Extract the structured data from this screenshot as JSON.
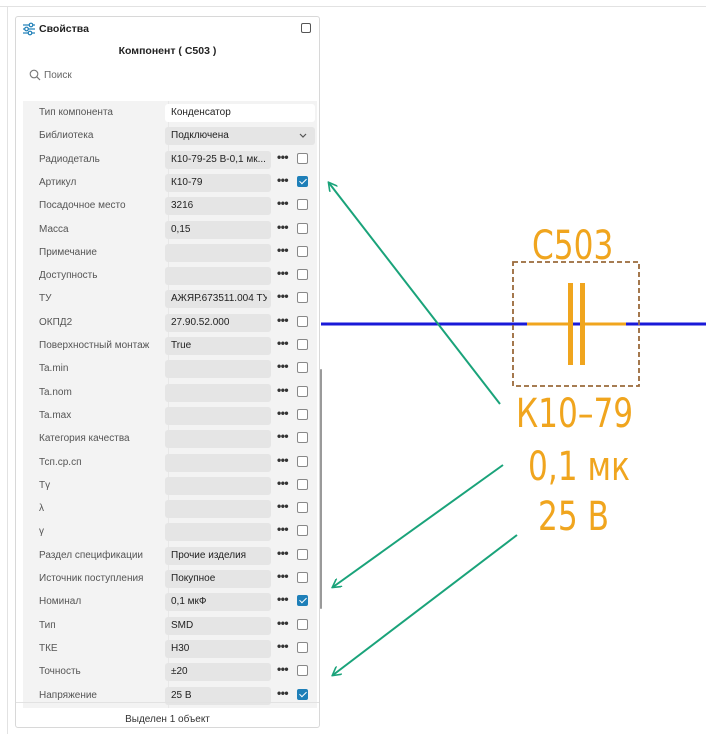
{
  "panel": {
    "title": "Свойства",
    "component_title": "Компонент ( С503 )",
    "search": {
      "placeholder": "Поиск"
    },
    "footer": "Выделен 1 объект",
    "rows": [
      {
        "label": "Тип компонента",
        "value": "Конденсатор",
        "kind": "input"
      },
      {
        "label": "Библиотека",
        "value": "Подключена",
        "kind": "select"
      },
      {
        "label": "Радиодеталь",
        "value": "К10-79-25 В-0,1 мк...",
        "checked": false
      },
      {
        "label": "Артикул",
        "value": "К10-79",
        "checked": true
      },
      {
        "label": "Посадочное место",
        "value": "3216",
        "checked": false
      },
      {
        "label": "Масса",
        "value": "0,15",
        "checked": false
      },
      {
        "label": "Примечание",
        "value": "",
        "checked": false
      },
      {
        "label": "Доступность",
        "value": "",
        "checked": false
      },
      {
        "label": "ТУ",
        "value": "АЖЯР.673511.004 ТУ",
        "checked": false
      },
      {
        "label": "ОКПД2",
        "value": "27.90.52.000",
        "checked": false
      },
      {
        "label": "Поверхностный монтаж",
        "value": "True",
        "checked": false
      },
      {
        "label": "Ta.min",
        "value": "",
        "checked": false
      },
      {
        "label": "Ta.nom",
        "value": "",
        "checked": false
      },
      {
        "label": "Ta.max",
        "value": "",
        "checked": false
      },
      {
        "label": "Категория качества",
        "value": "",
        "checked": false
      },
      {
        "label": "Тсп.ср.сп",
        "value": "",
        "checked": false
      },
      {
        "label": "Тγ",
        "value": "",
        "checked": false
      },
      {
        "label": "λ",
        "value": "",
        "checked": false
      },
      {
        "label": "γ",
        "value": "",
        "checked": false
      },
      {
        "label": "Раздел спецификации",
        "value": "Прочие изделия",
        "checked": false
      },
      {
        "label": "Источник поступления",
        "value": "Покупное",
        "checked": false
      },
      {
        "label": "Номинал",
        "value": "0,1 мкФ",
        "checked": true
      },
      {
        "label": "Тип",
        "value": "SMD",
        "checked": false
      },
      {
        "label": "ТКЕ",
        "value": "Н30",
        "checked": false
      },
      {
        "label": "Точность",
        "value": "±20",
        "checked": false
      },
      {
        "label": "Напряжение",
        "value": "25 В",
        "checked": true
      }
    ]
  },
  "schematic": {
    "ref": "С503",
    "line1": "К10–79",
    "line2": "0,1 мк",
    "line3": "25 В",
    "wire_color": "#1a1ad8",
    "part_color": "#f0a51e",
    "box_color": "#9a6a3a",
    "arrow_color": "#1aa37a"
  },
  "icons": {
    "panel": "sliders-icon",
    "search": "search-icon",
    "maximize": "maximize-icon",
    "dropdown": "chevron-down-icon",
    "more": "more-dots-icon"
  }
}
